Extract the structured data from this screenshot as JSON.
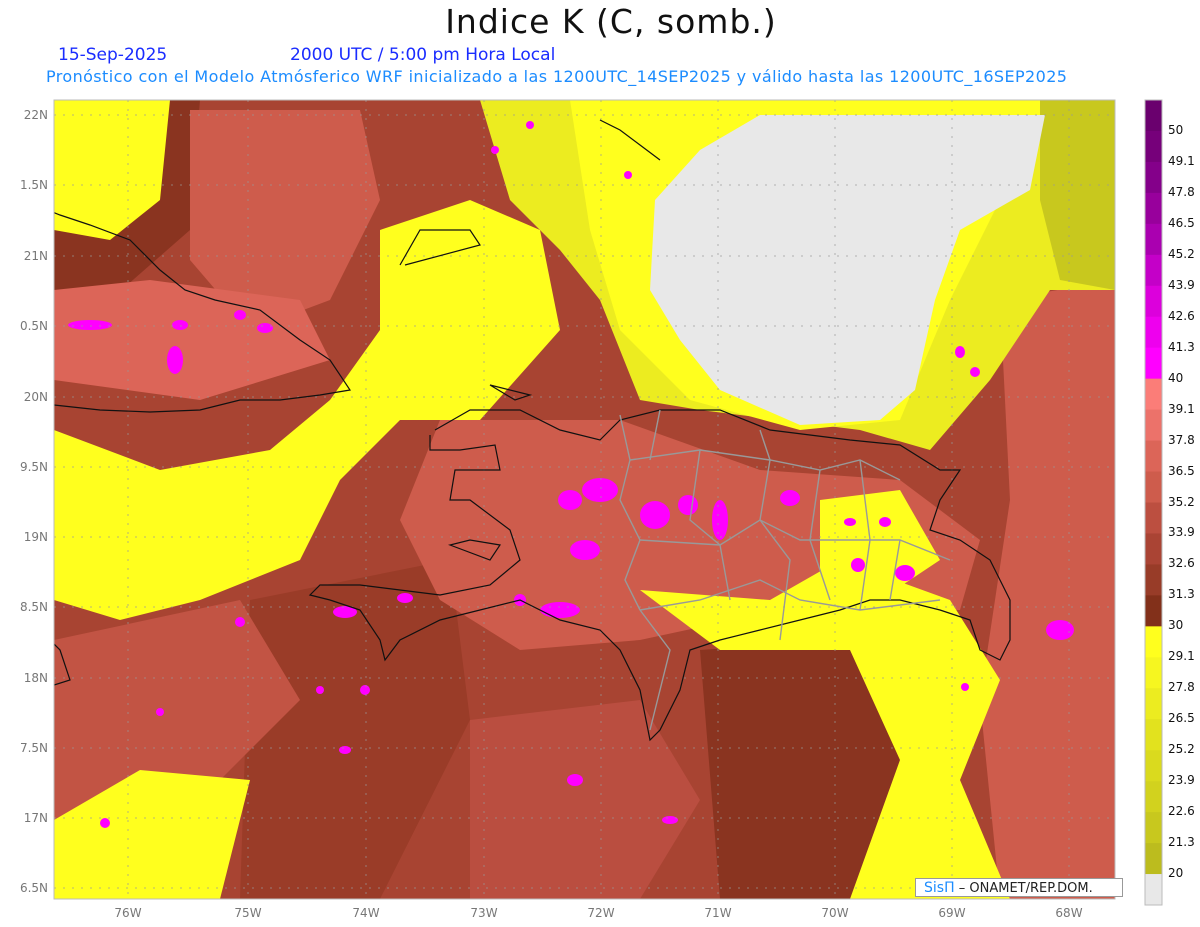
{
  "header": {
    "title": "Indice K (C, somb.)",
    "date": "15-Sep-2025",
    "time": "2000 UTC / 5:00 pm Hora Local",
    "forecast_info": "Pronóstico con el Modelo Atmósferico WRF inicializado a las 1200UTC_14SEP2025 y válido hasta las  1200UTC_16SEP2025"
  },
  "axes": {
    "lat_labels": [
      "22N",
      "1.5N",
      "21N",
      "0.5N",
      "20N",
      "9.5N",
      "19N",
      "8.5N",
      "18N",
      "7.5N",
      "17N",
      "6.5N"
    ],
    "lon_labels": [
      "76W",
      "75W",
      "74W",
      "73W",
      "72W",
      "71W",
      "70W",
      "69W",
      "68W"
    ]
  },
  "colorbar": {
    "labels": [
      "50",
      "49.1",
      "47.8",
      "46.5",
      "45.2",
      "43.9",
      "42.6",
      "41.3",
      "40",
      "39.1",
      "37.8",
      "36.5",
      "35.2",
      "33.9",
      "32.6",
      "31.3",
      "30",
      "29.1",
      "27.8",
      "26.5",
      "25.2",
      "23.9",
      "22.6",
      "21.3",
      "20"
    ],
    "colors": [
      "#6a006e",
      "#76007a",
      "#84008a",
      "#98009c",
      "#aa00b0",
      "#c400c8",
      "#dc00dc",
      "#ee00ee",
      "#ff00ff",
      "#fb7d78",
      "#ec726a",
      "#dc6558",
      "#ce5c4c",
      "#bc4f40",
      "#aa4434",
      "#983c28",
      "#82301a",
      "#ffff1e",
      "#f6f620",
      "#ecec20",
      "#e2e21e",
      "#dada1e",
      "#d2d21e",
      "#c8c81e",
      "#bcbc1e",
      "#e8e8e8"
    ]
  },
  "credit": {
    "logo": "SisΠ",
    "text": "– ONAMET/REP.DOM."
  }
}
